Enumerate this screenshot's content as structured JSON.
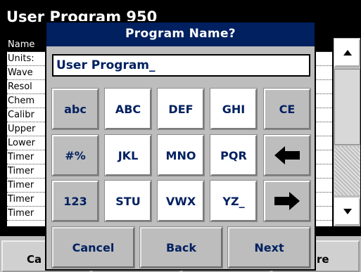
{
  "background": {
    "title": "User Program 950",
    "rows": [
      "Name",
      "Units:",
      "Wave",
      "Resol",
      "Chem",
      "Calibr",
      "Upper",
      "Lower",
      "Timer",
      "Timer",
      "Timer",
      "Timer",
      "Timer"
    ],
    "bottom_buttons": [
      "Ca",
      "",
      "",
      "re"
    ]
  },
  "dialog": {
    "title": "Program Name?",
    "input_value": "User Program_",
    "keys": [
      [
        "abc",
        "ABC",
        "DEF",
        "GHI",
        "CE"
      ],
      [
        "#%",
        "JKL",
        "MNO",
        "PQR",
        "left-arrow-icon"
      ],
      [
        "123",
        "STU",
        "VWX",
        "YZ_",
        "right-arrow-icon"
      ]
    ],
    "actions": {
      "cancel": "Cancel",
      "back": "Back",
      "next": "Next"
    }
  },
  "colors": {
    "title_bar": "#002060",
    "key_text": "#002060",
    "panel": "#bdbdbd"
  }
}
